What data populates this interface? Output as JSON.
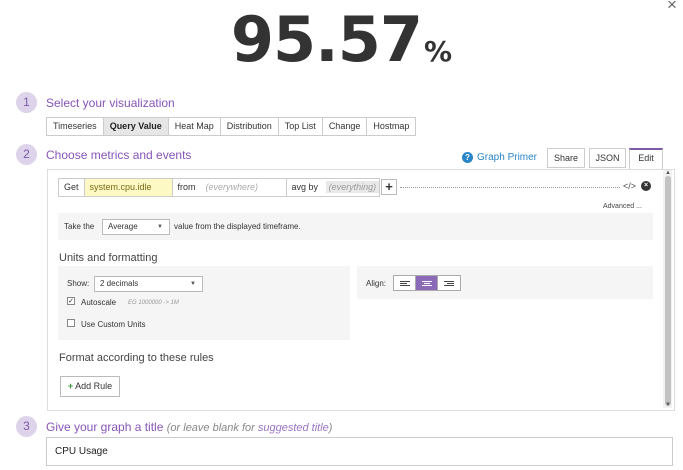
{
  "close_icon": "close-icon",
  "query_value": {
    "value": "95.57",
    "unit": "%"
  },
  "steps": [
    {
      "number": "1",
      "title": "Select your visualization"
    },
    {
      "number": "2",
      "title": "Choose metrics and events"
    },
    {
      "number": "3",
      "title": "Give your graph a title",
      "hint_prefix": "(or leave blank for ",
      "hint_link": "suggested title",
      "hint_suffix": ")"
    }
  ],
  "visualization_tabs": [
    "Timeseries",
    "Query Value",
    "Heat Map",
    "Distribution",
    "Top List",
    "Change",
    "Hostmap"
  ],
  "active_visualization": "Query Value",
  "graph_primer": {
    "label": "Graph Primer",
    "icon": "help-icon"
  },
  "mode_tabs": [
    "Share",
    "JSON",
    "Edit"
  ],
  "active_mode": "Edit",
  "query": {
    "get_label": "Get",
    "metric": "system.cpu.idle",
    "from_label": "from",
    "from_placeholder": "(everywhere)",
    "aggregator_label": "avg by",
    "group_placeholder": "(everything)",
    "add_icon": "+",
    "code_icon": "</>",
    "remove_icon": "×",
    "advanced_label": "Advanced ..."
  },
  "aggregation": {
    "prefix": "Take the",
    "selected": "Average",
    "suffix": "value from the displayed timeframe."
  },
  "units": {
    "section_title": "Units and formatting",
    "show_label": "Show:",
    "show_selected": "2 decimals",
    "autoscale_label": "Autoscale",
    "autoscale_checked": true,
    "autoscale_example": "EG 1000000 -> 1M",
    "custom_units_label": "Use Custom Units",
    "custom_units_checked": false,
    "align_label": "Align:",
    "align_options": [
      "left",
      "center",
      "right"
    ],
    "align_selected": "center"
  },
  "rules": {
    "section_title": "Format according to these rules",
    "add_plus": "+",
    "add_label": "Add Rule"
  },
  "graph_title": {
    "value": "CPU Usage"
  },
  "colors": {
    "accent_purple": "#8755b8",
    "step_circle_bg": "#ddd3ea",
    "metric_highlight": "#fdf9c4",
    "link_blue": "#2a85c6",
    "add_green": "#3c9b3c"
  }
}
